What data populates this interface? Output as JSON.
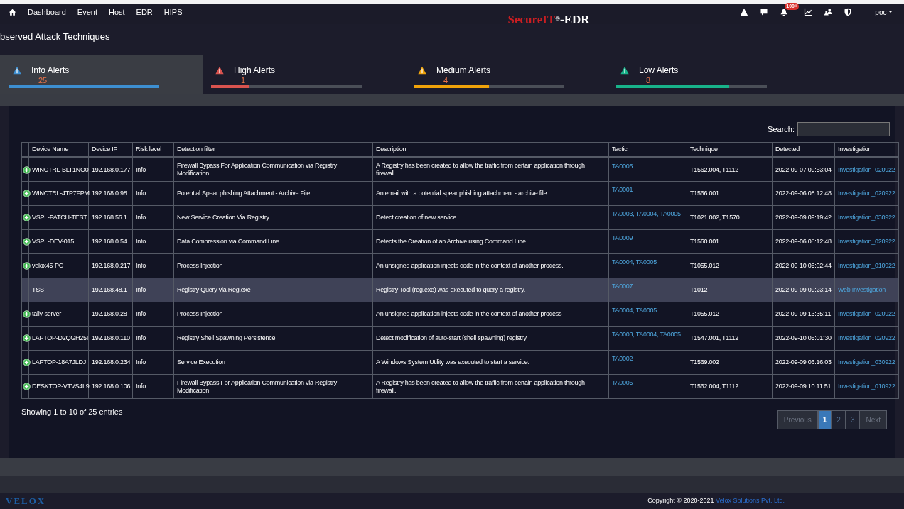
{
  "nav": {
    "items": [
      "Dashboard",
      "Event",
      "Host",
      "EDR",
      "HIPS"
    ]
  },
  "brand": {
    "name": "SecureIT",
    "mark": "®",
    "suffix": "-EDR"
  },
  "toolbar": {
    "notification_badge": "100+",
    "user": "poc"
  },
  "page_title": "bserved Attack Techniques",
  "alert_tabs": [
    {
      "label": "Info Alerts",
      "count": "25",
      "level": 1,
      "color": "#3d8fd1",
      "selected": true
    },
    {
      "label": "High Alerts",
      "count": "1",
      "level": 0.25,
      "color": "#d9534f",
      "selected": false
    },
    {
      "label": "Medium Alerts",
      "count": "4",
      "level": 0.5,
      "color": "#f0a30a",
      "selected": false
    },
    {
      "label": "Low Alerts",
      "count": "8",
      "level": 0.75,
      "color": "#18b38a",
      "selected": false
    }
  ],
  "search": {
    "label": "Search:"
  },
  "table": {
    "columns": [
      "Device Name",
      "Device IP",
      "Risk level",
      "Detection filter",
      "Description",
      "Tactic",
      "Technique",
      "Detected",
      "Investigation"
    ],
    "rows": [
      {
        "expandable": true,
        "selected": false,
        "cells": [
          "WINCTRL-BLT1NO0",
          "192.168.0.177",
          "Info",
          "Firewall Bypass For Application Communication via Registry Modification",
          "A Registry has been created to allow the traffic from certain application through firewall.",
          "TA0005",
          "T1562.004, T1112",
          "2022-09-07 09:53:04",
          "Investigation_020922"
        ]
      },
      {
        "expandable": true,
        "selected": false,
        "cells": [
          "WINCTRL-4TP7FPM",
          "192.168.0.98",
          "Info",
          "Potential Spear phishing Attachment - Archive File",
          "An email with a potential spear phishing attachment - archive file",
          "TA0001",
          "T1566.001",
          "2022-09-06 08:12:48",
          "Investigation_020922"
        ]
      },
      {
        "expandable": true,
        "selected": false,
        "cells": [
          "VSPL-PATCH-TEST",
          "192.168.56.1",
          "Info",
          "New Service Creation Via Registry",
          "Detect creation of new service",
          "TA0003, TA0004, TA0005",
          "T1021.002, T1570",
          "2022-09-09 09:19:42",
          "Investigation_030922"
        ]
      },
      {
        "expandable": true,
        "selected": false,
        "cells": [
          "VSPL-DEV-015",
          "192.168.0.54",
          "Info",
          "Data Compression via Command Line",
          "Detects the Creation of an Archive using Command Line",
          "TA0009",
          "T1560.001",
          "2022-09-06 08:12:48",
          "Investigation_020922"
        ]
      },
      {
        "expandable": true,
        "selected": false,
        "cells": [
          "velox45-PC",
          "192.168.0.217",
          "Info",
          "Process Injection",
          "An unsigned application injects code in the context of another process.",
          "TA0004, TA0005",
          "T1055.012",
          "2022-09-10 05:02:44",
          "Investigation_010922"
        ]
      },
      {
        "expandable": false,
        "selected": true,
        "cells": [
          "TSS",
          "192.168.48.1",
          "Info",
          "Registry Query via Reg.exe",
          "Registry Tool (reg.exe) was executed to query a registry.",
          "TA0007",
          "T1012",
          "2022-09-09 09:23:14",
          "Web Investigation"
        ]
      },
      {
        "expandable": true,
        "selected": false,
        "cells": [
          "tally-server",
          "192.168.0.28",
          "Info",
          "Process Injection",
          "An unsigned application injects code in the context of another process",
          "TA0004, TA0005",
          "T1055.012",
          "2022-09-09 13:35:11",
          "Investigation_020922"
        ]
      },
      {
        "expandable": true,
        "selected": false,
        "cells": [
          "LAPTOP-D2QGH25I",
          "192.168.0.110",
          "Info",
          "Registry Shell Spawning Persistence",
          "Detect modification of auto-start (shell spawning) registry",
          "TA0003, TA0004, TA0005",
          "T1547.001, T1112",
          "2022-09-10 05:01:30",
          "Investigation_020922"
        ]
      },
      {
        "expandable": true,
        "selected": false,
        "cells": [
          "LAPTOP-18A7JLDJ",
          "192.168.0.234",
          "Info",
          "Service Execution",
          "A Windows System Utility was executed to start a service.",
          "TA0002",
          "T1569.002",
          "2022-09-09 06:16:03",
          "Investigation_030922"
        ]
      },
      {
        "expandable": true,
        "selected": false,
        "cells": [
          "DESKTOP-VTVS4L9",
          "192.168.0.106",
          "Info",
          "Firewall Bypass For Application Communication via Registry Modification",
          "A Registry has been created to allow the traffic from certain application through firewall.",
          "TA0005",
          "T1562.004, T1112",
          "2022-09-09 10:11:51",
          "Investigation_010922"
        ]
      }
    ]
  },
  "table_info": "Showing 1 to 10 of 25 entries",
  "pagination": [
    {
      "label": "Previous",
      "kind": "nav",
      "selected": false,
      "disabled": true
    },
    {
      "label": "1",
      "kind": "page",
      "selected": true,
      "disabled": false
    },
    {
      "label": "2",
      "kind": "page",
      "selected": false,
      "disabled": false
    },
    {
      "label": "3",
      "kind": "page",
      "selected": false,
      "disabled": false
    },
    {
      "label": "Next",
      "kind": "nav",
      "selected": false,
      "disabled": true
    }
  ],
  "footer": {
    "logo": "VELOX",
    "copyright": "Copyright © 2020-2021",
    "company_link": "Velox Solutions Pvt. Ltd."
  }
}
